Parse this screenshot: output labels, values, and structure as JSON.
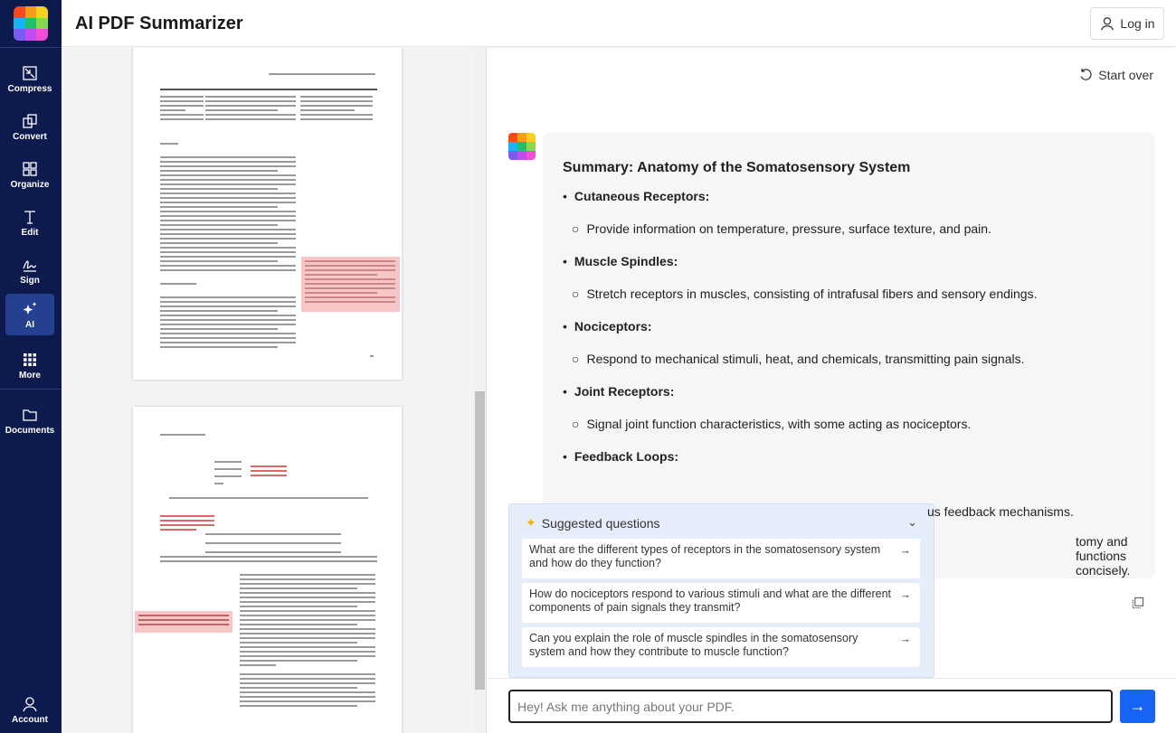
{
  "app": {
    "title": "AI PDF Summarizer",
    "login_label": "Log in",
    "brand_colors": [
      "#f54a1f",
      "#f79b1a",
      "#f7d21c",
      "#18b4f5",
      "#1fc06a",
      "#86d94a",
      "#7a5cf5",
      "#c04cf2",
      "#f24cd8"
    ]
  },
  "sidebar": {
    "items": [
      {
        "label": "Compress",
        "icon": "compress-icon"
      },
      {
        "label": "Convert",
        "icon": "convert-icon"
      },
      {
        "label": "Organize",
        "icon": "grid-icon"
      },
      {
        "label": "Edit",
        "icon": "text-icon"
      },
      {
        "label": "Sign",
        "icon": "signature-icon"
      },
      {
        "label": "AI",
        "icon": "sparkle-icon",
        "active": true
      },
      {
        "label": "More",
        "icon": "dots-grid-icon"
      },
      {
        "label": "Documents",
        "icon": "folder-icon"
      },
      {
        "label": "Account",
        "icon": "user-icon"
      }
    ]
  },
  "chat": {
    "start_over": "Start over",
    "summary_title": "Summary: Anatomy of the Somatosensory System",
    "sections": [
      {
        "heading": "Cutaneous Receptors:",
        "detail": "Provide information on temperature, pressure, surface texture, and pain."
      },
      {
        "heading": "Muscle Spindles:",
        "detail": "Stretch receptors in muscles, consisting of intrafusal fibers and sensory endings."
      },
      {
        "heading": "Nociceptors:",
        "detail": "Respond to mechanical stimuli, heat, and chemicals, transmitting pain signals."
      },
      {
        "heading": "Joint Receptors:",
        "detail": "Signal joint function characteristics, with some acting as nociceptors."
      },
      {
        "heading": "Feedback Loops:",
        "detail": "us feedback mechanisms."
      }
    ],
    "trailing_text": "tomy and functions concisely.",
    "suggested": {
      "title": "Suggested questions",
      "questions": [
        "What are the different types of receptors in the somatosensory system and how do they function?",
        "How do nociceptors respond to various stimuli and what are the different components of pain signals they transmit?",
        "Can you explain the role of muscle spindles in the somatosensory system and how they contribute to muscle function?"
      ]
    },
    "input_placeholder": "Hey! Ask me anything about your PDF.",
    "accent": "#1765f5"
  }
}
